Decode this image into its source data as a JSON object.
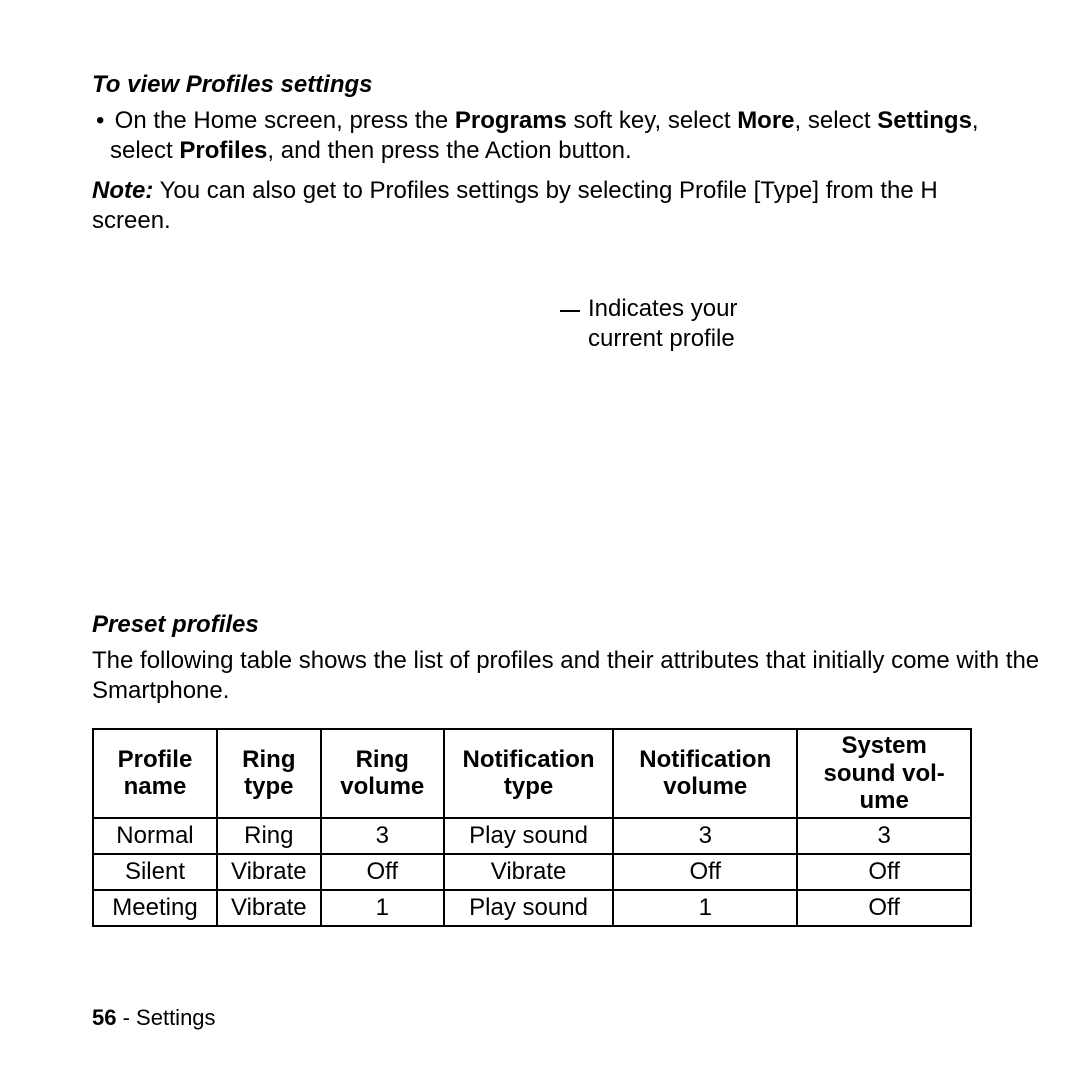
{
  "section1": {
    "title": "To view Profiles settings",
    "bullet_prefix": "On the Home screen, press the ",
    "b1": "Programs",
    "mid1": " soft key, select ",
    "b2": "More",
    "mid2": ", select ",
    "b3": "Settings",
    "mid3": ", select ",
    "b4": "Profiles",
    "tail": ", and then press the Action button."
  },
  "note": {
    "label": "Note:",
    "text": " You can also get to Profiles settings by selecting Profile [Type] from the H",
    "tail": "screen."
  },
  "callout": {
    "line1": "Indicates your",
    "line2": "current profile"
  },
  "section2": {
    "title": "Preset profiles",
    "desc": "The following table shows the list of profiles and their attributes that initially come with the Smartphone."
  },
  "table": {
    "headers": {
      "c0": "Profile name",
      "c1": "Ring type",
      "c2": "Ring volume",
      "c3": "Notification type",
      "c4": "Notification volume",
      "c5": "System sound vol-ume"
    },
    "rows": [
      {
        "c0": "Normal",
        "c1": "Ring",
        "c2": "3",
        "c3": "Play sound",
        "c4": "3",
        "c5": "3"
      },
      {
        "c0": "Silent",
        "c1": "Vibrate",
        "c2": "Off",
        "c3": "Vibrate",
        "c4": "Off",
        "c5": "Off"
      },
      {
        "c0": "Meeting",
        "c1": "Vibrate",
        "c2": "1",
        "c3": "Play sound",
        "c4": "1",
        "c5": "Off"
      }
    ]
  },
  "footer": {
    "page": "56",
    "sep": " - ",
    "label": "Settings"
  }
}
